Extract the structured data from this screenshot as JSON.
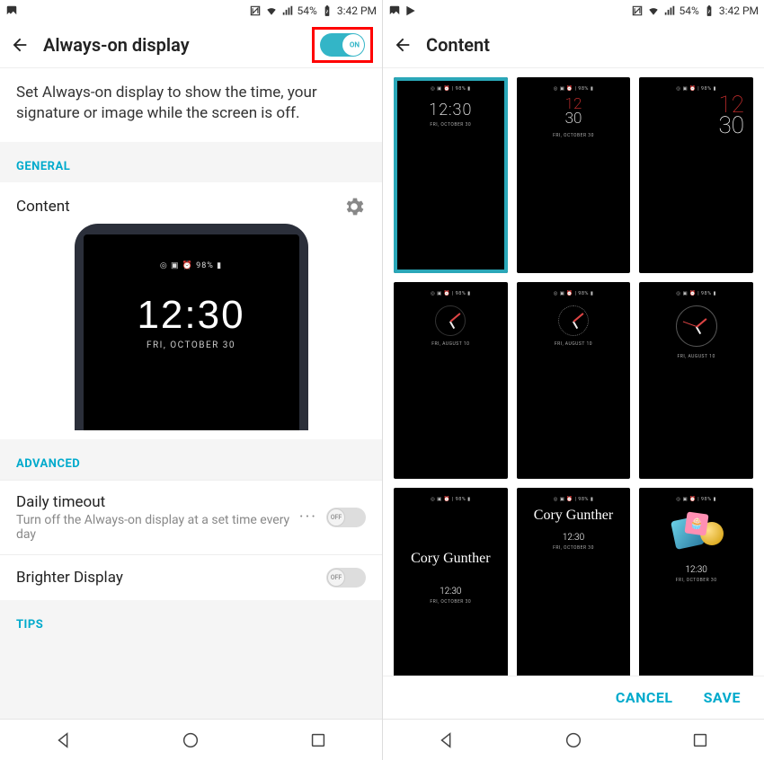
{
  "status": {
    "battery": "54%",
    "time": "3:42 PM"
  },
  "left": {
    "title": "Always-on display",
    "toggle_state": "ON",
    "description": "Set Always-on display to show the time, your signature or image while the screen is off.",
    "sections": {
      "general": "GENERAL",
      "advanced": "ADVANCED",
      "tips": "TIPS"
    },
    "content_row": "Content",
    "preview": {
      "status_line": "◎ ▣ ⏰  98% ▮",
      "time": "12:30",
      "date": "FRI, OCTOBER 30"
    },
    "daily_timeout": {
      "label": "Daily timeout",
      "sub": "Turn off the Always-on display at a set time every day",
      "state": "OFF"
    },
    "brighter": {
      "label": "Brighter Display",
      "state": "OFF"
    }
  },
  "right": {
    "title": "Content",
    "actions": {
      "cancel": "CANCEL",
      "save": "SAVE"
    },
    "thumb_status": "◎ ▣ ⏰ | 98% ▮",
    "thumbs": [
      {
        "selected": true,
        "style": "digital-thin",
        "time": "12:30",
        "date": "FRI, OCTOBER 30"
      },
      {
        "selected": false,
        "style": "digital-split",
        "hr": "12",
        "min": "30",
        "date": "FRI, OCTOBER 30"
      },
      {
        "selected": false,
        "style": "digital-big",
        "hr": "12",
        "min": "30",
        "date": ""
      },
      {
        "selected": false,
        "style": "analog-simple",
        "date": "FRI, AUGUST 10"
      },
      {
        "selected": false,
        "style": "analog-dots",
        "date": "FRI, AUGUST 10"
      },
      {
        "selected": false,
        "style": "analog-full",
        "date": "FRI, AUGUST 10"
      },
      {
        "selected": false,
        "style": "signature-low",
        "sig": "Cory Gunther",
        "time": "12:30",
        "date": "FRI, OCTOBER 30"
      },
      {
        "selected": false,
        "style": "signature-high",
        "sig": "Cory Gunther",
        "time": "12:30",
        "date": "FRI, OCTOBER 30"
      },
      {
        "selected": false,
        "style": "image",
        "time": "12:30",
        "date": "FRI, OCTOBER 30"
      }
    ]
  }
}
